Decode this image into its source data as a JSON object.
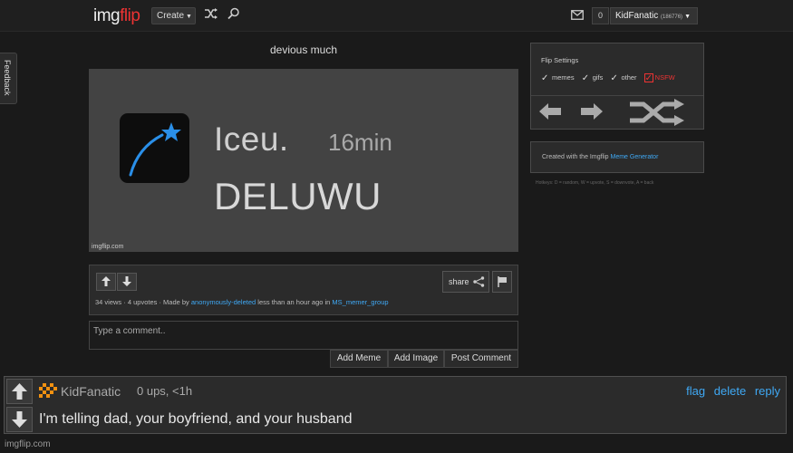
{
  "header": {
    "logo_img": "img",
    "logo_flip": "flip",
    "create_label": "Create",
    "notification_count": "0",
    "username": "KidFanatic",
    "user_points": "(186776)"
  },
  "feedback_label": "Feedback",
  "meme": {
    "title": "devious much",
    "image_text_name": "Iceu.",
    "image_text_time": "16min",
    "image_text_main": "DELUWU",
    "watermark": "imgflip.com",
    "stats_prefix": "34 views · 4 upvotes · Made by ",
    "author": "anonymously-deleted",
    "stats_middle": " less than an hour ago in ",
    "stream": "MS_memer_group",
    "share_label": "share"
  },
  "comment_input": {
    "placeholder": "Type a comment..",
    "add_meme": "Add Meme",
    "add_image": "Add Image",
    "post_comment": "Post Comment"
  },
  "flip_settings": {
    "title": "Flip Settings",
    "options": [
      "memes",
      "gifs",
      "other",
      "NSFW"
    ]
  },
  "created_box": {
    "prefix": "Created with the Imgflip ",
    "link": "Meme Generator"
  },
  "hotkeys": "Hotkeys: D = random, W = upvote, S = downvote, A = back",
  "comment": {
    "username": "KidFanatic",
    "meta": "0 ups, <1h",
    "actions": [
      "flag",
      "delete",
      "reply"
    ],
    "text": "I'm telling dad, your boyfriend, and your husband"
  },
  "bottom_watermark": "imgflip.com",
  "colors": {
    "background": "#1a1a1a",
    "accent_link": "#3fa9f5",
    "logo_red": "#e33333",
    "app_icon_blue": "#2a8fe8"
  },
  "icons": [
    "shuffle-icon",
    "search-icon",
    "mail-icon",
    "arrow-up-icon",
    "arrow-down-icon",
    "share-icon",
    "flag-icon",
    "arrow-left-icon",
    "arrow-right-icon",
    "star-icon"
  ]
}
